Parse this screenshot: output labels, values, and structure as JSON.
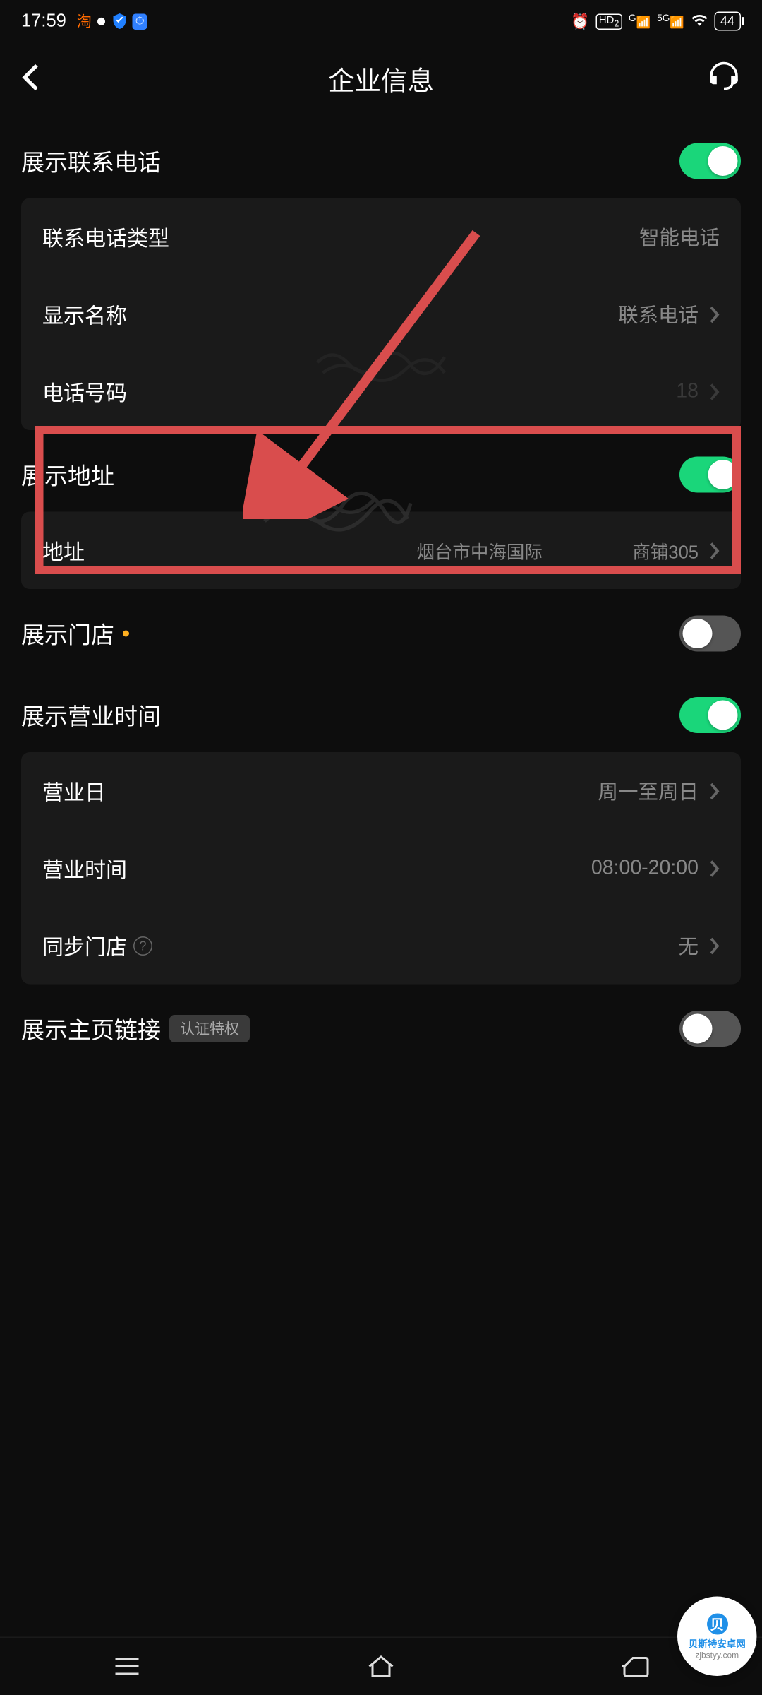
{
  "status": {
    "time": "17:59",
    "battery": "44"
  },
  "header": {
    "title": "企业信息"
  },
  "sections": {
    "phone": {
      "title": "展示联系电话",
      "rows": {
        "type_label": "联系电话类型",
        "type_value": "智能电话",
        "name_label": "显示名称",
        "name_value": "联系电话",
        "number_label": "电话号码",
        "number_value": "18"
      }
    },
    "address": {
      "title": "展示地址",
      "rows": {
        "addr_label": "地址",
        "addr_value": "烟台市中海国际　　　　　商铺305"
      }
    },
    "store": {
      "title": "展示门店"
    },
    "hours": {
      "title": "展示营业时间",
      "rows": {
        "days_label": "营业日",
        "days_value": "周一至周日",
        "time_label": "营业时间",
        "time_value": "08:00-20:00",
        "sync_label": "同步门店",
        "sync_value": "无"
      }
    },
    "link": {
      "title": "展示主页链接",
      "badge": "认证特权"
    }
  },
  "watermark": {
    "line1": "贝斯特安卓网",
    "line2": "zjbstyy.com"
  }
}
